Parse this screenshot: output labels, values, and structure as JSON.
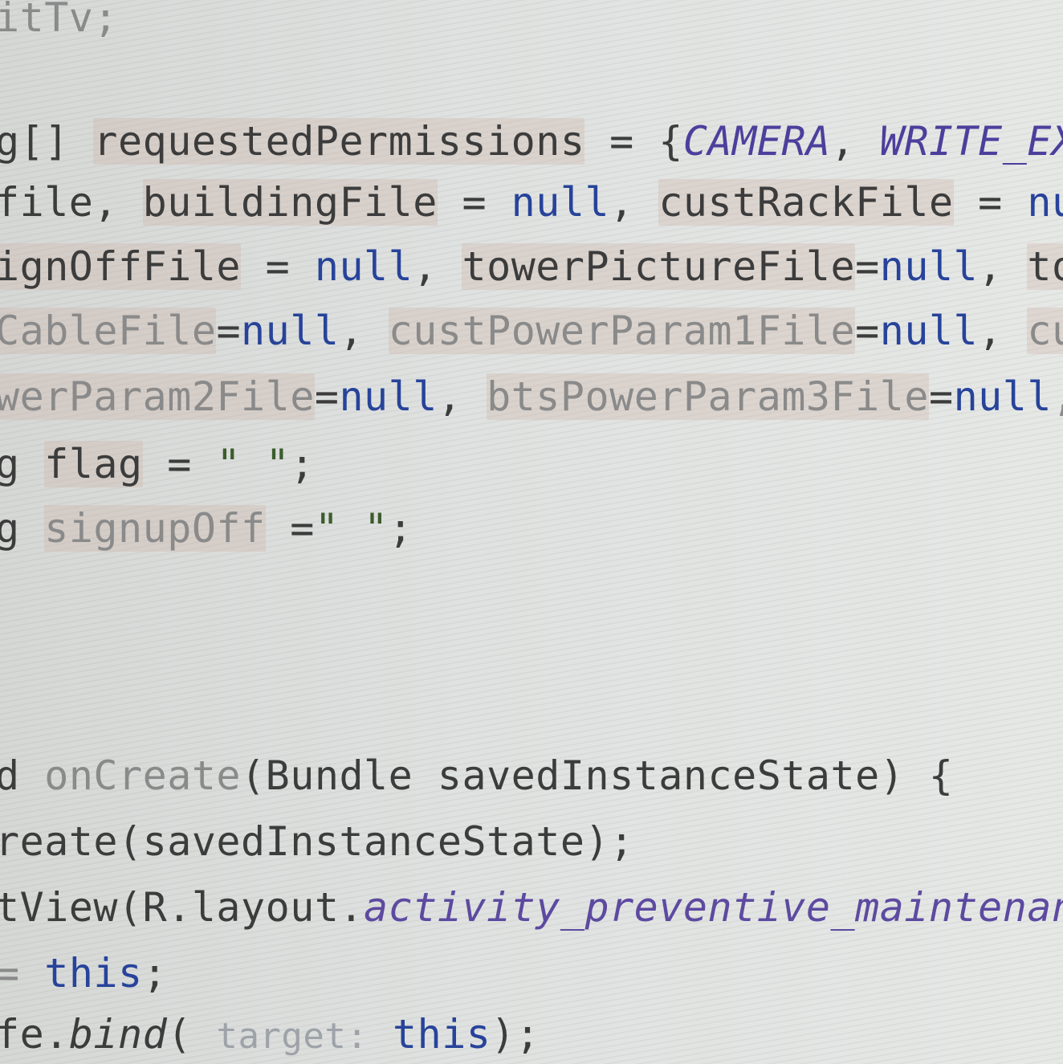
{
  "editor": {
    "lines": [
      {
        "tokens": [
          {
            "text": "itTv;",
            "cls": "faded"
          }
        ]
      },
      {
        "tokens": [
          {
            "text": "g[] "
          },
          {
            "text": "requestedPermissions",
            "cls": "hl"
          },
          {
            "text": " = {"
          },
          {
            "text": "CAMERA",
            "cls": "const"
          },
          {
            "text": ", "
          },
          {
            "text": "WRITE_EXTER",
            "cls": "const"
          }
        ]
      },
      {
        "tokens": [
          {
            "text": "file, "
          },
          {
            "text": "buildingFile",
            "cls": "hl"
          },
          {
            "text": " = "
          },
          {
            "text": "null",
            "cls": "kw-null"
          },
          {
            "text": ", "
          },
          {
            "text": "custRackFile",
            "cls": "hl"
          },
          {
            "text": " = "
          },
          {
            "text": "null",
            "cls": "kw-null"
          }
        ]
      },
      {
        "tokens": [
          {
            "text": "ignOffFile",
            "cls": "hl"
          },
          {
            "text": " = "
          },
          {
            "text": "null",
            "cls": "kw-null"
          },
          {
            "text": ", "
          },
          {
            "text": "towerPictureFile",
            "cls": "hl"
          },
          {
            "text": "="
          },
          {
            "text": "null",
            "cls": "kw-null"
          },
          {
            "text": ", "
          },
          {
            "text": "tower",
            "cls": "hl"
          }
        ]
      },
      {
        "tokens": [
          {
            "text": "CableFile",
            "cls": "hl faded"
          },
          {
            "text": "="
          },
          {
            "text": "null",
            "cls": "kw-null"
          },
          {
            "text": ", "
          },
          {
            "text": "custPowerParam1File",
            "cls": "hl faded"
          },
          {
            "text": "="
          },
          {
            "text": "null",
            "cls": "kw-null"
          },
          {
            "text": ", "
          },
          {
            "text": "custP",
            "cls": "hl faded"
          }
        ]
      },
      {
        "tokens": [
          {
            "text": "werParam2File",
            "cls": "hl faded"
          },
          {
            "text": "="
          },
          {
            "text": "null",
            "cls": "kw-null"
          },
          {
            "text": ", "
          },
          {
            "text": "btsPowerParam3File",
            "cls": "hl faded"
          },
          {
            "text": "="
          },
          {
            "text": "null",
            "cls": "kw-null"
          },
          {
            "text": ", r",
            "cls": "faded"
          }
        ]
      },
      {
        "tokens": [
          {
            "text": "g "
          },
          {
            "text": "flag",
            "cls": "hl"
          },
          {
            "text": " = "
          },
          {
            "text": "\" \"",
            "cls": "str"
          },
          {
            "text": ";"
          }
        ]
      },
      {
        "tokens": [
          {
            "text": "g "
          },
          {
            "text": "signupOff",
            "cls": "hl faded"
          },
          {
            "text": " ="
          },
          {
            "text": "\" \"",
            "cls": "str"
          },
          {
            "text": ";"
          }
        ]
      },
      {
        "tokens": [
          {
            "text": "d "
          },
          {
            "text": "onCreate",
            "cls": "faded"
          },
          {
            "text": "(Bundle savedInstanceState) {"
          }
        ]
      },
      {
        "tokens": [
          {
            "text": "reate(savedInstanceState);"
          }
        ]
      },
      {
        "tokens": [
          {
            "text": "tView(R.layout."
          },
          {
            "text": "activity_preventive_maintenance",
            "cls": "italic-purple"
          }
        ]
      },
      {
        "tokens": [
          {
            "text": "= ",
            "cls": "faded"
          },
          {
            "text": "this",
            "cls": "kw-this"
          },
          {
            "text": ";"
          }
        ]
      },
      {
        "tokens": [
          {
            "text": "fe."
          },
          {
            "text": "bind",
            "cls": "method-ital"
          },
          {
            "text": "( "
          },
          {
            "text": "target:",
            "cls": "hint"
          },
          {
            "text": " "
          },
          {
            "text": "this",
            "cls": "kw-this"
          },
          {
            "text": ");"
          }
        ]
      }
    ]
  }
}
